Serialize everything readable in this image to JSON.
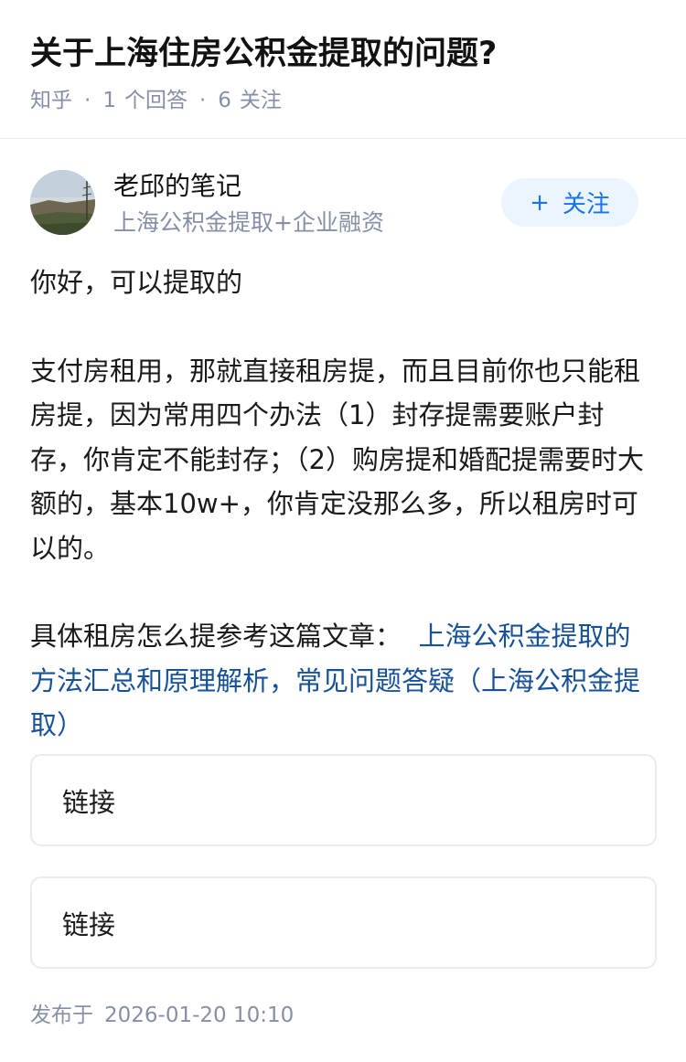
{
  "question": {
    "title": "关于上海住房公积金提取的问题?",
    "source": "知乎",
    "separator": "·",
    "answer_count": "1",
    "answer_label": "个回答",
    "follower_count": "6",
    "follower_label": "关注"
  },
  "author": {
    "name": "老邱的笔记",
    "bio": "上海公积金提取+企业融资",
    "follow_plus": "+",
    "follow_label": "关注"
  },
  "answer": {
    "para1": "你好，可以提取的",
    "para2": "支付房租用，那就直接租房提，而且目前你也只能租房提，因为常用四个办法（1）封存提需要账户封存，你肯定不能封存；（2）购房提和婚配提需要时大额的，基本10w+，你肯定没那么多，所以租房时可以的。",
    "para3_prefix": "具体租房怎么提参考这篇文章：",
    "para3_link": "上海公积金提取的方法汇总和原理解析，常见问题答疑（上海公积金提取）",
    "link_card_1": "链接",
    "link_card_2": "链接"
  },
  "footer": {
    "published_label": "发布于",
    "published_time": "2026-01-20 10:10"
  },
  "colors": {
    "link": "#175199",
    "follow_button_bg": "#ebf5ff",
    "follow_button_text": "#1772f6",
    "meta_gray": "#8590a6"
  }
}
